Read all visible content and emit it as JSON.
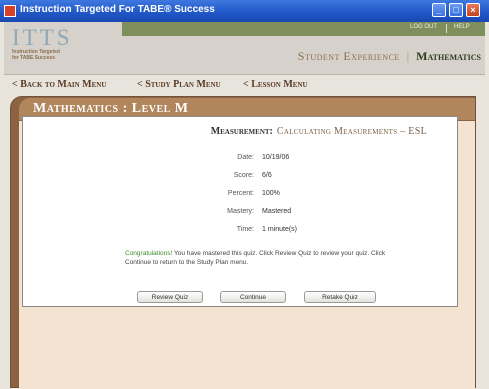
{
  "window": {
    "title": "Instruction Targeted For TABE® Success"
  },
  "header": {
    "logo_big": "ITTS",
    "logo_small_line1": "Instruction Targeted",
    "logo_small_line2": "for TABE Success",
    "logout": "Log Out",
    "help": "Help",
    "student_experience": "Student Experience",
    "separator": "|",
    "subject": "Mathematics"
  },
  "nav": {
    "back_main": "< Back to Main Menu",
    "study_plan": "< Study Plan Menu",
    "lesson": "< Lesson Menu"
  },
  "panel": {
    "title": "Mathematics : Level M"
  },
  "quiz": {
    "heading_label": "Measurement:",
    "heading_value": "Calculating Measurements – ESL",
    "rows": [
      {
        "key": "Date:",
        "value": "10/19/06"
      },
      {
        "key": "Score:",
        "value": "6/6"
      },
      {
        "key": "Percent:",
        "value": "100%"
      },
      {
        "key": "Mastery:",
        "value": "Mastered"
      },
      {
        "key": "Time:",
        "value": "1 minute(s)"
      }
    ],
    "congrats": "Congratulations!",
    "message": " You have mastered this quiz. Click Review Quiz to review your quiz. Click Continue to return to the Study Plan menu.",
    "buttons": {
      "review": "Review Quiz",
      "continue": "Continue",
      "retake": "Retake Quiz"
    }
  },
  "colors": {
    "titlebar": "#1f56c6",
    "panel": "#8c6342",
    "panel_head": "#b1865d",
    "panel_body": "#f3e3d0",
    "green_strip": "#7e8f5d"
  }
}
